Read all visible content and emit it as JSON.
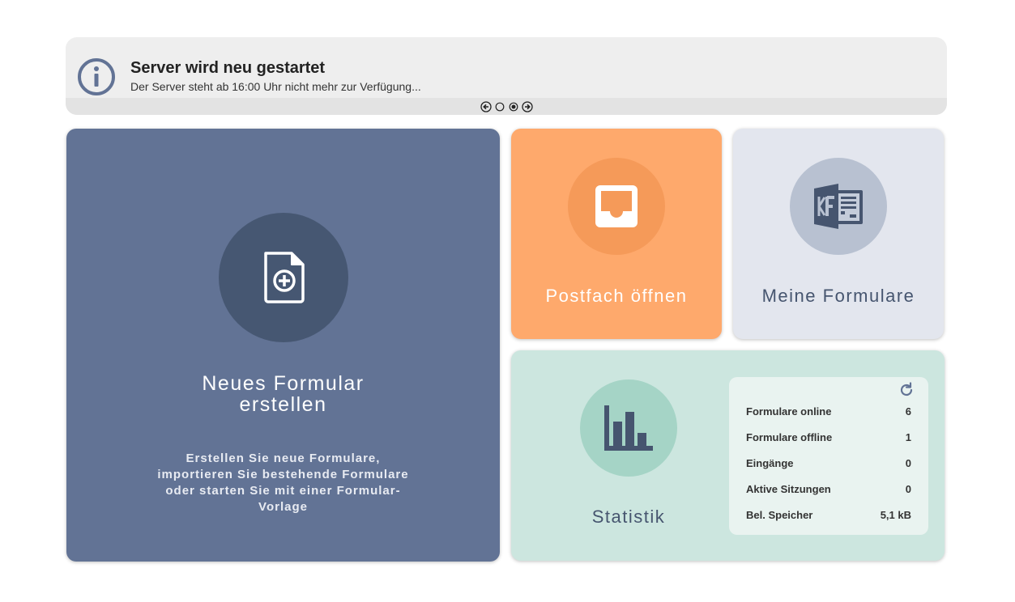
{
  "banner": {
    "icon": "info-icon",
    "title": "Server wird neu gestartet",
    "text": "Der Server steht ab 16:00 Uhr nicht mehr zur Verfügung...",
    "nav": {
      "prev_icon": "arrow-left-circle-icon",
      "next_icon": "arrow-right-circle-icon",
      "dots": 2,
      "active_dot": 2
    }
  },
  "tiles": {
    "new_form": {
      "icon": "document-plus-icon",
      "title_line1": "Neues Formular",
      "title_line2": "erstellen",
      "desc_line1": "Erstellen Sie neue Formulare,",
      "desc_line2": "importieren Sie bestehende Formulare",
      "desc_line3": "oder starten Sie mit einer Formular-",
      "desc_line4": "Vorlage",
      "color": "#627395"
    },
    "inbox": {
      "icon": "inbox-icon",
      "title": "Postfach öffnen",
      "color": "#fea96c"
    },
    "my_forms": {
      "icon": "forms-logo-icon",
      "title": "Meine Formulare",
      "color": "#e3e6ee"
    },
    "stats": {
      "icon": "bar-chart-icon",
      "title": "Statistik",
      "refresh_icon": "refresh-icon",
      "color": "#cce6df",
      "rows": [
        {
          "label": "Formulare online",
          "value": "6"
        },
        {
          "label": "Formulare offline",
          "value": "1"
        },
        {
          "label": "Eingänge",
          "value": "0"
        },
        {
          "label": "Aktive Sitzungen",
          "value": "0"
        },
        {
          "label": "Bel. Speicher",
          "value": "5,1 kB"
        }
      ]
    }
  }
}
